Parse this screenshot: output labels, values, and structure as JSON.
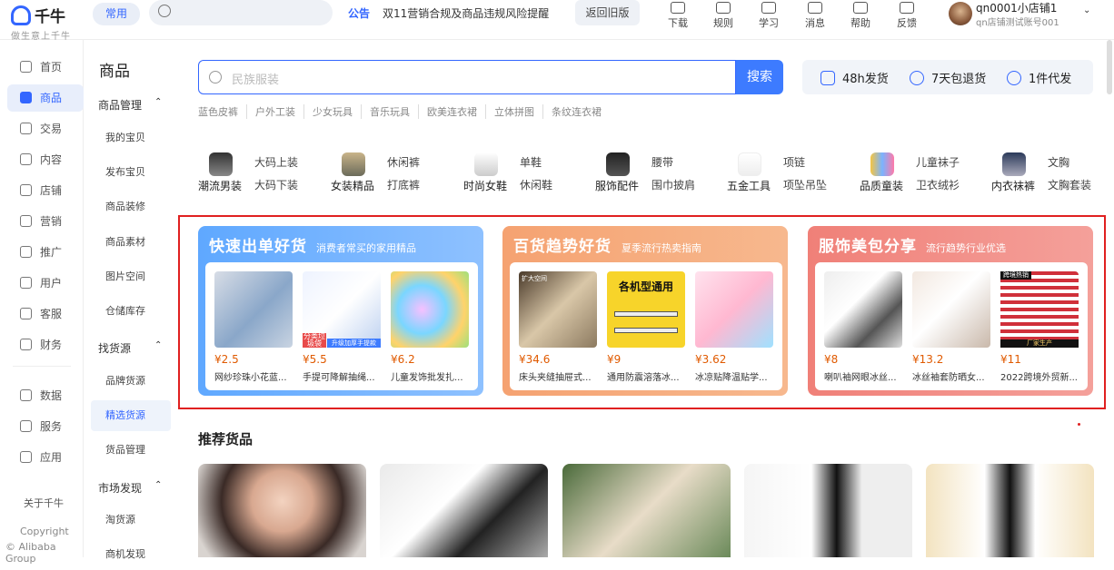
{
  "app": {
    "name": "千牛",
    "slogan": "做生意上千牛"
  },
  "topbar": {
    "common_tag": "常用",
    "notice_label": "公告",
    "notice_text": "双11营销合规及商品违规风险提醒",
    "old_version": "返回旧版",
    "tools": [
      {
        "label": "下载",
        "icon": "download-icon"
      },
      {
        "label": "规则",
        "icon": "rules-icon"
      },
      {
        "label": "学习",
        "icon": "study-icon"
      },
      {
        "label": "消息",
        "icon": "message-icon"
      },
      {
        "label": "帮助",
        "icon": "help-icon"
      },
      {
        "label": "反馈",
        "icon": "feedback-icon"
      }
    ],
    "user_name": "qn0001小店铺1",
    "user_sub": "qn店铺测试账号001"
  },
  "leftnav": {
    "items": [
      {
        "label": "首页",
        "icon": "home-icon"
      },
      {
        "label": "商品",
        "icon": "goods-icon",
        "active": true
      },
      {
        "label": "交易",
        "icon": "trade-icon"
      },
      {
        "label": "内容",
        "icon": "content-icon"
      },
      {
        "label": "店铺",
        "icon": "shop-icon"
      },
      {
        "label": "营销",
        "icon": "marketing-icon"
      },
      {
        "label": "推广",
        "icon": "promote-icon"
      },
      {
        "label": "用户",
        "icon": "user-icon"
      },
      {
        "label": "客服",
        "icon": "service-icon"
      },
      {
        "label": "财务",
        "icon": "finance-icon"
      },
      {
        "label": "数据",
        "icon": "data-icon"
      },
      {
        "label": "服务",
        "icon": "grid-icon"
      },
      {
        "label": "应用",
        "icon": "app-icon"
      }
    ],
    "about": "关于千牛",
    "copyright": "Copyright",
    "company": "© Alibaba Group"
  },
  "subnav": {
    "title": "商品",
    "group1": "商品管理",
    "group1_items": [
      "我的宝贝",
      "发布宝贝",
      "商品装修",
      "商品素材",
      "图片空间",
      "仓储库存"
    ],
    "group2": "找货源",
    "group2_items": [
      "品牌货源",
      "精选货源",
      "货品管理"
    ],
    "group3": "市场发现",
    "group3_items": [
      "淘货源",
      "商机发现"
    ]
  },
  "search": {
    "placeholder": "民族服装",
    "button": "搜索"
  },
  "services": [
    "48h发货",
    "7天包退货",
    "1件代发"
  ],
  "hot_words": [
    "蓝色皮裤",
    "户外工装",
    "少女玩具",
    "音乐玩具",
    "欧美连衣裙",
    "立体拼图",
    "条纹连衣裙"
  ],
  "categories": [
    {
      "main": "潮流男装",
      "sub": [
        "大码上装",
        "大码下装"
      ]
    },
    {
      "main": "女装精品",
      "sub": [
        "休闲裤",
        "打底裤"
      ]
    },
    {
      "main": "时尚女鞋",
      "sub": [
        "单鞋",
        "休闲鞋"
      ]
    },
    {
      "main": "服饰配件",
      "sub": [
        "腰带",
        "围巾披肩"
      ]
    },
    {
      "main": "五金工具",
      "sub": [
        "项链",
        "项坠吊坠"
      ]
    },
    {
      "main": "品质童装",
      "sub": [
        "儿童袜子",
        "卫衣绒衫"
      ]
    },
    {
      "main": "内衣袜裤",
      "sub": [
        "文胸",
        "文胸套装"
      ]
    }
  ],
  "promos": [
    {
      "title": "快速出单好货",
      "subtitle": "消费者常买的家用精品",
      "products": [
        {
          "price": "¥2.5",
          "title": "网纱珍珠小花蓝..."
        },
        {
          "price": "¥5.5",
          "title": "手提可降解抽绳..."
        },
        {
          "price": "¥6.2",
          "title": "儿童发饰批发扎..."
        }
      ]
    },
    {
      "title": "百货趋势好货",
      "subtitle": "夏季流行热卖指南",
      "products": [
        {
          "price": "¥34.6",
          "title": "床头夹缝抽屉式..."
        },
        {
          "price": "¥9",
          "title": "通用防震溶落冰..."
        },
        {
          "price": "¥3.62",
          "title": "冰凉贴降温贴学..."
        }
      ]
    },
    {
      "title": "服饰美包分享",
      "subtitle": "流行趋势行业优选",
      "products": [
        {
          "price": "¥8",
          "title": "喇叭袖网眼冰丝..."
        },
        {
          "price": "¥13.2",
          "title": "冰丝袖套防晒女..."
        },
        {
          "price": "¥11",
          "title": "2022跨境外贸新..."
        }
      ]
    }
  ],
  "image_texts": [
    "分类垃圾袋",
    "升级加厚手提款",
    "扩大空间",
    "各机型通用",
    "跨境热销",
    "厂家生产"
  ],
  "recommend_title": "推荐货品",
  "colors": {
    "accent": "#3366ff",
    "highlight": "#e02020",
    "price": "#e05a00"
  }
}
